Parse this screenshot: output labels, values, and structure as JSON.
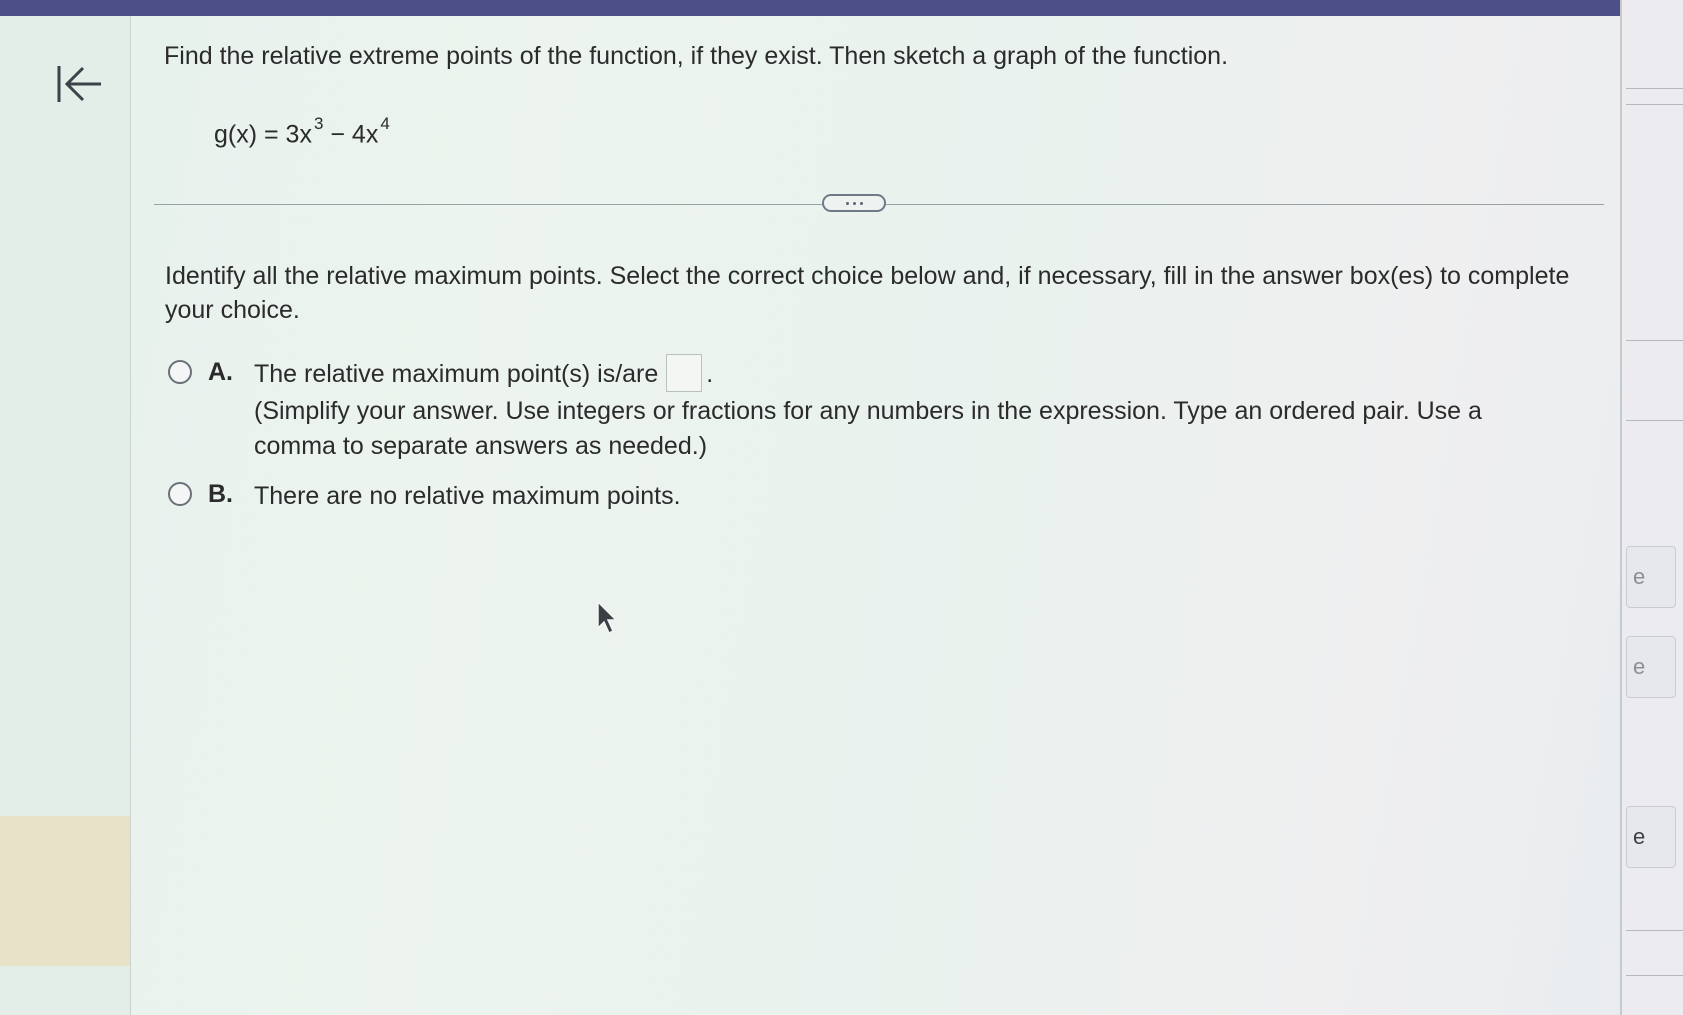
{
  "question": {
    "prompt": "Find the relative extreme points of the function, if they exist. Then sketch a graph of the function.",
    "function_lhs": "g(x) = 3x",
    "function_exp1": "3",
    "function_mid": " − 4x",
    "function_exp2": "4"
  },
  "instruction": "Identify all the relative maximum points. Select the correct choice below and, if necessary, fill in the answer box(es) to complete your choice.",
  "choices": [
    {
      "letter": "A.",
      "text": "The relative maximum point(s) is/are",
      "answer_value": "",
      "hint": "(Simplify your answer. Use integers or fractions for any numbers in the expression. Type an ordered pair. Use a comma to separate answers as needed.)"
    },
    {
      "letter": "B.",
      "text": "There are no relative maximum points."
    }
  ],
  "right_panel": {
    "button_letters": [
      "e",
      "e",
      "e"
    ]
  },
  "icons": {
    "back": "back-to-start-icon",
    "expand": "more-dots-icon",
    "cursor": "mouse-pointer-icon"
  },
  "colors": {
    "top_bar": "#4c4f88",
    "text": "#2b2b2b"
  }
}
